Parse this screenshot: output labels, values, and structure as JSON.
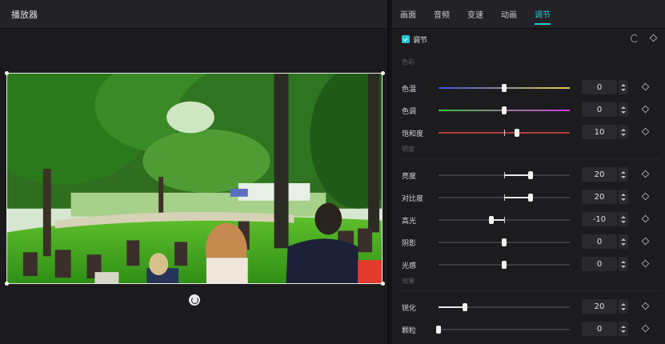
{
  "player": {
    "title": "播放器"
  },
  "tabs": [
    {
      "label": "画面",
      "active": false
    },
    {
      "label": "音频",
      "active": false
    },
    {
      "label": "变速",
      "active": false
    },
    {
      "label": "动画",
      "active": false
    },
    {
      "label": "调节",
      "active": true
    }
  ],
  "adjust": {
    "enabled": true,
    "title": "调节",
    "groups": {
      "color": "色彩",
      "lightness": "明度",
      "effects": "效果"
    },
    "sliders": {
      "temperature": {
        "label": "色温",
        "value": "0",
        "min": -50,
        "max": 50,
        "level": 0
      },
      "tint": {
        "label": "色调",
        "value": "0",
        "min": -50,
        "max": 50,
        "level": 0
      },
      "saturation": {
        "label": "饱和度",
        "value": "10",
        "min": -50,
        "max": 50,
        "level": 10
      },
      "brightness": {
        "label": "亮度",
        "value": "20",
        "min": -50,
        "max": 50,
        "level": 20
      },
      "contrast": {
        "label": "对比度",
        "value": "20",
        "min": -50,
        "max": 50,
        "level": 20
      },
      "highlight": {
        "label": "高光",
        "value": "-10",
        "min": -50,
        "max": 50,
        "level": -10
      },
      "shadow": {
        "label": "阴影",
        "value": "0",
        "min": -50,
        "max": 50,
        "level": 0
      },
      "light": {
        "label": "光感",
        "value": "0",
        "min": -50,
        "max": 50,
        "level": 0
      },
      "sharpen": {
        "label": "锐化",
        "value": "20",
        "min": 0,
        "max": 100,
        "level": 20
      },
      "grain": {
        "label": "颗粒",
        "value": "0",
        "min": 0,
        "max": 100,
        "level": 0
      }
    }
  },
  "colors": {
    "accent": "#29c5d6",
    "temperature_gradient": [
      "#3a4fd8",
      "#e8c94a"
    ],
    "tint_gradient": [
      "#3fbf3f",
      "#d43fd8"
    ],
    "saturation_track": "#b43b3b"
  },
  "icons": {
    "reset": "reset-icon",
    "keyframe": "diamond-icon",
    "rotate": "rotate-icon"
  }
}
